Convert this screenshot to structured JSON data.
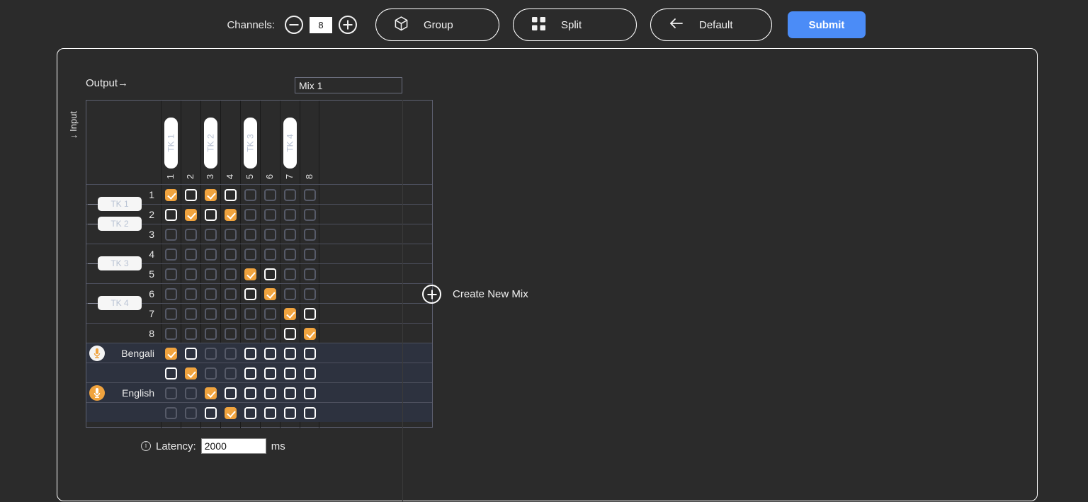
{
  "toolbar": {
    "channels_label": "Channels:",
    "channels_value": "8",
    "decrement_label": "−",
    "increment_label": "+",
    "group_label": "Group",
    "split_label": "Split",
    "default_label": "Default",
    "submit_label": "Submit",
    "submit_color": "#4b8cf7"
  },
  "panel": {
    "output_label": "Output→",
    "input_label": "↓ Input",
    "mix_name_value": "Mix 1",
    "mix_name_placeholder": "Mix 1"
  },
  "matrix": {
    "column_tk_labels": [
      "TK 1",
      "TK 2",
      "TK 3",
      "TK 4"
    ],
    "column_numbers": [
      "1",
      "2",
      "3",
      "4",
      "5",
      "6",
      "7",
      "8"
    ],
    "row_tk_labels": [
      "TK 1",
      "TK 2",
      "TK 3",
      "TK 4"
    ],
    "checked_color": "#f0a33e",
    "rows": [
      {
        "label": "1",
        "icon": "",
        "states": [
          "on",
          "off",
          "on",
          "off",
          "dis",
          "dis",
          "dis",
          "dis"
        ]
      },
      {
        "label": "2",
        "icon": "",
        "states": [
          "off",
          "on",
          "off",
          "on",
          "dis",
          "dis",
          "dis",
          "dis"
        ]
      },
      {
        "label": "3",
        "icon": "",
        "states": [
          "dis",
          "dis",
          "dis",
          "dis",
          "dis",
          "dis",
          "dis",
          "dis"
        ]
      },
      {
        "label": "4",
        "icon": "",
        "states": [
          "dis",
          "dis",
          "dis",
          "dis",
          "dis",
          "dis",
          "dis",
          "dis"
        ]
      },
      {
        "label": "5",
        "icon": "",
        "states": [
          "dis",
          "dis",
          "dis",
          "dis",
          "on",
          "off",
          "dis",
          "dis"
        ]
      },
      {
        "label": "6",
        "icon": "",
        "states": [
          "dis",
          "dis",
          "dis",
          "dis",
          "off",
          "on",
          "dis",
          "dis"
        ]
      },
      {
        "label": "7",
        "icon": "",
        "states": [
          "dis",
          "dis",
          "dis",
          "dis",
          "dis",
          "dis",
          "on",
          "off"
        ]
      },
      {
        "label": "8",
        "icon": "",
        "states": [
          "dis",
          "dis",
          "dis",
          "dis",
          "dis",
          "dis",
          "off",
          "on"
        ]
      },
      {
        "label": "Bengali",
        "icon": "microphone-light-icon",
        "states": [
          "on",
          "off",
          "dis",
          "dis",
          "off",
          "off",
          "off",
          "off"
        ]
      },
      {
        "label": "",
        "icon": "",
        "states": [
          "off",
          "on",
          "dis",
          "dis",
          "off",
          "off",
          "off",
          "off"
        ]
      },
      {
        "label": "English",
        "icon": "microphone-orange-icon",
        "states": [
          "dis",
          "dis",
          "on",
          "off",
          "off",
          "off",
          "off",
          "off"
        ]
      },
      {
        "label": "",
        "icon": "",
        "states": [
          "dis",
          "dis",
          "off",
          "on",
          "off",
          "off",
          "off",
          "off"
        ]
      }
    ]
  },
  "latency": {
    "label": "Latency:",
    "value": "2000",
    "unit": "ms"
  },
  "create_mix": {
    "label": "Create New Mix"
  }
}
